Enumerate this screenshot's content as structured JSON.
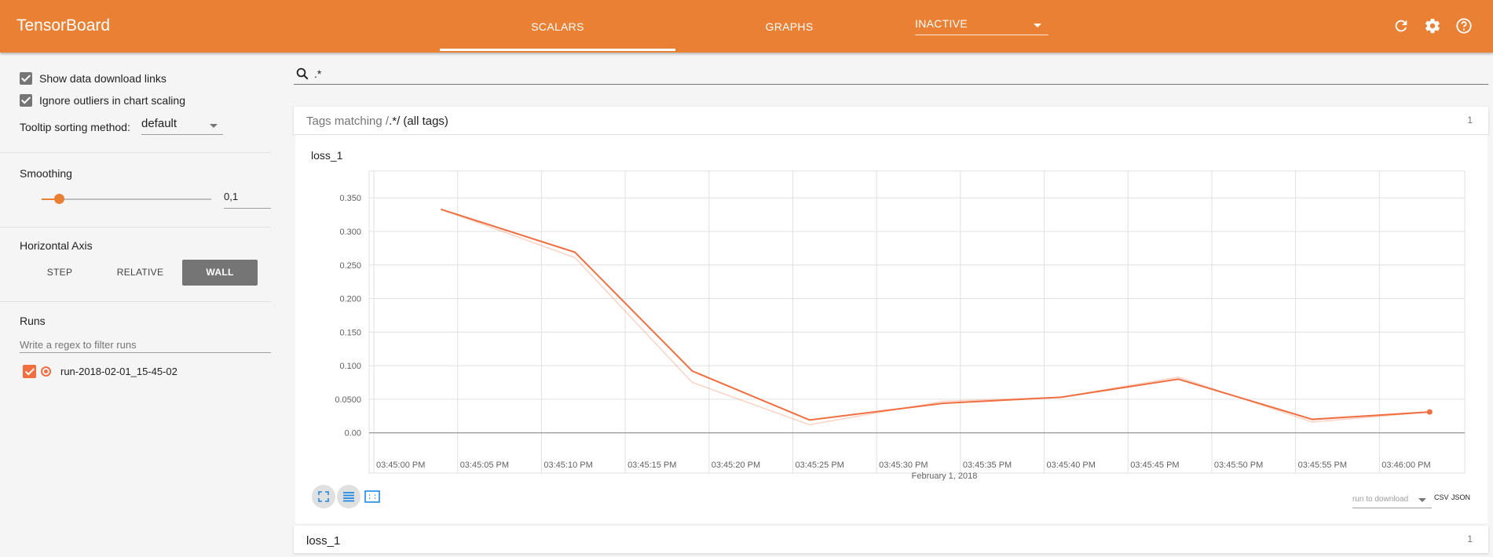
{
  "app": {
    "title": "TensorBoard"
  },
  "nav": {
    "tabs": [
      {
        "label": "SCALARS",
        "active": true
      },
      {
        "label": "GRAPHS",
        "active": false
      }
    ],
    "inactive_label": "INACTIVE"
  },
  "icons": {
    "refresh": "refresh-icon",
    "settings": "gear-icon",
    "help": "help-icon",
    "search": "search-icon"
  },
  "colors": {
    "accent": "#e98034",
    "series": "#f06e3f"
  },
  "sidebar": {
    "show_download_links": {
      "label": "Show data download links",
      "checked": true
    },
    "ignore_outliers": {
      "label": "Ignore outliers in chart scaling",
      "checked": true
    },
    "tooltip_sorting": {
      "label": "Tooltip sorting method:",
      "value": "default"
    },
    "smoothing": {
      "title": "Smoothing",
      "value": "0,1",
      "level": 0.1
    },
    "horizontal_axis": {
      "title": "Horizontal Axis",
      "options": [
        "STEP",
        "RELATIVE",
        "WALL"
      ],
      "selected": "WALL"
    },
    "runs": {
      "title": "Runs",
      "filter_placeholder": "Write a regex to filter runs",
      "items": [
        {
          "name": "run-2018-02-01_15-45-02",
          "checked": true
        }
      ]
    }
  },
  "main": {
    "search_value": ".*",
    "tag_group": {
      "prefix": "Tags matching /",
      "regex": ".*",
      "suffix": "/ (all tags)",
      "count": "1"
    },
    "download": {
      "select_placeholder": "run to download",
      "csv": "CSV",
      "json": "JSON"
    },
    "second_group": {
      "title": "loss_1",
      "count": "1"
    }
  },
  "chart_data": {
    "type": "line",
    "title": "loss_1",
    "xlabel": "February 1, 2018",
    "ylabel": "",
    "x_ticks": [
      "03:45:00 PM",
      "03:45:05 PM",
      "03:45:10 PM",
      "03:45:15 PM",
      "03:45:20 PM",
      "03:45:25 PM",
      "03:45:30 PM",
      "03:45:35 PM",
      "03:45:40 PM",
      "03:45:45 PM",
      "03:45:50 PM",
      "03:45:55 PM",
      "03:46:00 PM"
    ],
    "y_ticks": [
      "0.350",
      "0.300",
      "0.250",
      "0.200",
      "0.150",
      "0.100",
      "0.0500",
      "0.00"
    ],
    "ylim": [
      -0.06,
      0.39
    ],
    "grid": true,
    "series": [
      {
        "name": "run-2018-02-01_15-45-02",
        "x": [
          "03:45:04 PM",
          "03:45:12 PM",
          "03:45:19 PM",
          "03:45:26 PM",
          "03:45:34 PM",
          "03:45:41 PM",
          "03:45:48 PM",
          "03:45:56 PM",
          "03:46:03 PM"
        ],
        "raw": [
          0.333,
          0.261,
          0.075,
          0.012,
          0.047,
          0.053,
          0.083,
          0.016,
          0.031
        ],
        "smoothed": [
          0.333,
          0.269,
          0.092,
          0.019,
          0.044,
          0.053,
          0.08,
          0.02,
          0.031
        ]
      }
    ]
  }
}
